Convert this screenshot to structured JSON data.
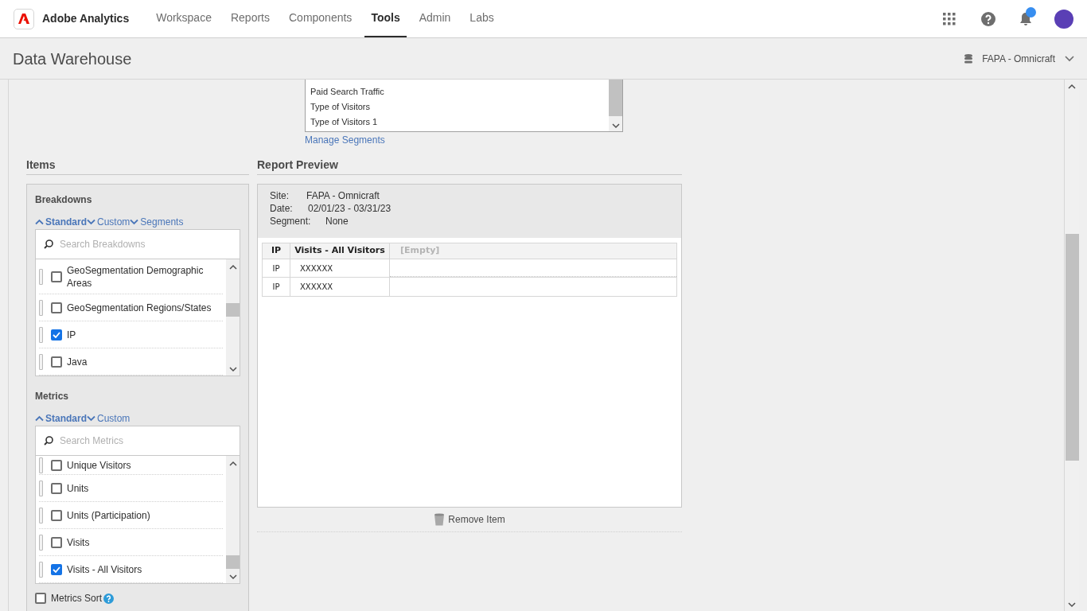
{
  "app": {
    "name": "Adobe Analytics"
  },
  "nav": [
    {
      "label": "Workspace",
      "selected": false
    },
    {
      "label": "Reports",
      "selected": false
    },
    {
      "label": "Components",
      "selected": false
    },
    {
      "label": "Tools",
      "selected": true
    },
    {
      "label": "Admin",
      "selected": false
    },
    {
      "label": "Labs",
      "selected": false
    }
  ],
  "notifications": {
    "unread": true
  },
  "page": {
    "title": "Data Warehouse",
    "report_suite": "FAPA - Omnicraft"
  },
  "segments": {
    "items": [
      "Paid Search Traffic",
      "Type of Visitors",
      "Type of Visitors 1"
    ],
    "link": "Manage Segments"
  },
  "items_panel": {
    "title": "Items",
    "sections": [
      {
        "title": "Breakdowns",
        "filters": [
          {
            "label": "Standard",
            "expanded": true
          },
          {
            "label": "Custom",
            "expanded": false
          },
          {
            "label": "Segments",
            "expanded": false
          }
        ],
        "search_placeholder": "Search Breakdowns",
        "items": [
          {
            "label": "GeoSegmentation Demographic Areas",
            "checked": false
          },
          {
            "label": "GeoSegmentation Regions/States",
            "checked": false
          },
          {
            "label": "IP",
            "checked": true
          },
          {
            "label": "Java",
            "checked": false
          }
        ]
      },
      {
        "title": "Metrics",
        "filters": [
          {
            "label": "Standard",
            "expanded": true
          },
          {
            "label": "Custom",
            "expanded": false
          }
        ],
        "search_placeholder": "Search Metrics",
        "items": [
          {
            "label": "Unique Visitors",
            "checked": false
          },
          {
            "label": "Units",
            "checked": false
          },
          {
            "label": "Units (Participation)",
            "checked": false
          },
          {
            "label": "Visits",
            "checked": false
          },
          {
            "label": "Visits - All Visitors",
            "checked": true
          }
        ]
      }
    ],
    "metrics_sort": {
      "label": "Metrics Sort",
      "checked": false
    }
  },
  "preview": {
    "title": "Report Preview",
    "info": [
      {
        "label": "Site:",
        "value": "FAPA - Omnicraft"
      },
      {
        "label": "Date:",
        "value": "02/01/23 - 03/31/23"
      },
      {
        "label": "Segment:",
        "value": "None"
      }
    ],
    "table": {
      "columns": [
        "IP",
        "Visits - All Visitors",
        "[Empty]"
      ],
      "rows": [
        [
          "IP",
          "XXXXXX"
        ],
        [
          "IP",
          "XXXXXX"
        ]
      ]
    },
    "remove_label": "Remove Item"
  }
}
